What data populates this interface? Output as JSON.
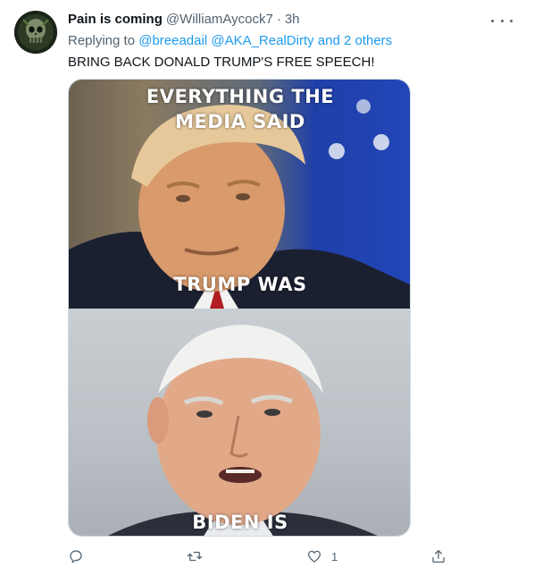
{
  "tweet": {
    "display_name": "Pain is coming",
    "handle": "@WilliamAycock7",
    "separator": "·",
    "time": "3h",
    "replying_prefix": "Replying to ",
    "mentions": [
      "@breeadail",
      "@AKA_RealDirty"
    ],
    "others": "and 2 others",
    "text": "BRING BACK DONALD TRUMP'S FREE SPEECH!"
  },
  "media": {
    "top_line1": "EVERYTHING THE",
    "top_line2": "MEDIA SAID",
    "top_caption": "TRUMP WAS",
    "bottom_caption": "BIDEN IS"
  },
  "actions": {
    "reply_count": "",
    "retweet_count": "",
    "like_count": "1"
  },
  "icons": {
    "reply": "reply-icon",
    "retweet": "retweet-icon",
    "like": "heart-icon",
    "share": "share-icon",
    "more": "more-icon"
  },
  "colors": {
    "accent": "#1d9bf0",
    "secondary_text": "#536471",
    "primary_text": "#0f1419"
  }
}
